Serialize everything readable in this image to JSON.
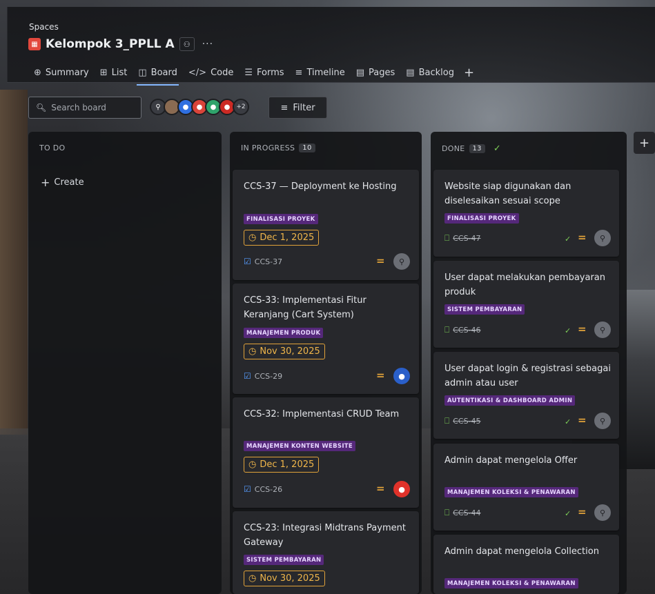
{
  "header": {
    "spaces_label": "Spaces",
    "project_name": "Kelompok 3_PPLL A",
    "more_label": "···",
    "tabs": [
      {
        "label": "Summary",
        "icon": "globe-icon",
        "glyph": "⊕"
      },
      {
        "label": "List",
        "icon": "list-icon",
        "glyph": "⊞"
      },
      {
        "label": "Board",
        "icon": "board-icon",
        "glyph": "◫"
      },
      {
        "label": "Code",
        "icon": "code-icon",
        "glyph": "</>"
      },
      {
        "label": "Forms",
        "icon": "forms-icon",
        "glyph": "☰"
      },
      {
        "label": "Timeline",
        "icon": "timeline-icon",
        "glyph": "≡"
      },
      {
        "label": "Pages",
        "icon": "pages-icon",
        "glyph": "▤"
      },
      {
        "label": "Backlog",
        "icon": "backlog-icon",
        "glyph": "▤"
      }
    ],
    "add_tab": "+"
  },
  "toolbar": {
    "search_placeholder": "Search board",
    "avatars_more": "+2",
    "filter_label": "Filter"
  },
  "columns": {
    "todo": {
      "title": "TO DO",
      "create_label": "Create"
    },
    "progress": {
      "title": "IN PROGRESS",
      "count": "10"
    },
    "done": {
      "title": "DONE",
      "count": "13"
    }
  },
  "progress_cards": [
    {
      "title": "CCS-37 — Deployment ke Hosting",
      "tag": "FINALISASI PROYEK",
      "due": "Dec 1, 2025",
      "key": "CCS-37"
    },
    {
      "title": "CCS-33: Implementasi Fitur Keranjang (Cart System)",
      "tag": "MANAJEMEN PRODUK",
      "due": "Nov 30, 2025",
      "key": "CCS-29"
    },
    {
      "title": "CCS-32: Implementasi CRUD Team",
      "tag": "MANAJEMEN KONTEN WEBSITE",
      "due": "Dec 1, 2025",
      "key": "CCS-26"
    },
    {
      "title": "CCS-23: Integrasi Midtrans Payment Gateway",
      "tag": "SISTEM PEMBAYARAN",
      "due": "Nov 30, 2025"
    }
  ],
  "done_cards": [
    {
      "title": "Website siap digunakan dan diselesaikan sesuai scope",
      "tag": "FINALISASI PROYEK",
      "key": "CCS-47"
    },
    {
      "title": "User dapat melakukan pembayaran produk",
      "tag": "SISTEM PEMBAYARAN",
      "key": "CCS-46"
    },
    {
      "title": "User dapat login & registrasi sebagai admin atau user",
      "tag": "AUTENTIKASI & DASHBOARD ADMIN",
      "key": "CCS-45"
    },
    {
      "title": "Admin dapat mengelola Offer",
      "tag": "MANAJEMEN KOLEKSI & PENAWARAN",
      "key": "CCS-44"
    },
    {
      "title": "Admin dapat mengelola Collection",
      "tag": "MANAJEMEN KOLEKSI & PENAWARAN"
    }
  ],
  "colors": {
    "accent": "#85b8ff",
    "tag_bg": "#55287a",
    "due_border": "#e2a33a",
    "done_green": "#7ed058"
  }
}
